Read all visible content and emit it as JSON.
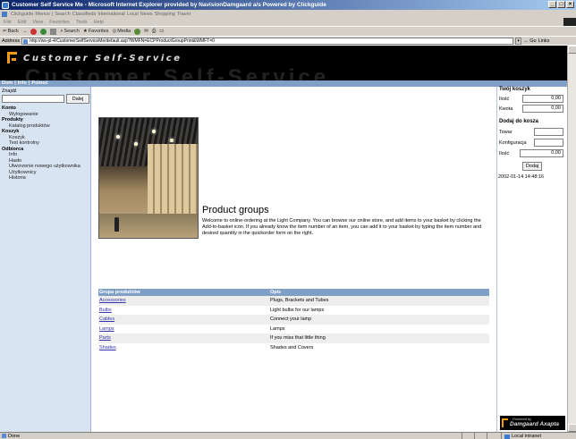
{
  "window": {
    "title": "Customer Self Service Me - Microsoft Internet Explorer provided by NavisionDamgaard a/s Powered by Clickguide"
  },
  "links_bar": [
    "Clickguide",
    "Menus",
    "Search",
    "Classifieds",
    "International",
    "Local",
    "News",
    "Shopping",
    "Travel"
  ],
  "menubar": [
    "File",
    "Edit",
    "View",
    "Favorites",
    "Tools",
    "Help"
  ],
  "toolbar": {
    "back": "Back",
    "search": "Search",
    "favorites": "Favorites",
    "media": "Media"
  },
  "address": {
    "label": "Address",
    "url": "http://ws-pl-4/CustomerSelfServiceMe/default.asp?WMFN=ECPProductGroupPrint&WMFT=0",
    "go": "Go",
    "links": "Links"
  },
  "site": {
    "title": "Customer Self-Service",
    "nav": [
      "Dom",
      "Info",
      "Pomoc"
    ]
  },
  "sidebar": {
    "search_label": "Znajdź",
    "search_value": "",
    "search_button": "Dalej",
    "sections": [
      {
        "title": "Konto",
        "items": [
          "Wylogowanie"
        ]
      },
      {
        "title": "Produkty",
        "items": [
          "Katalog produktów"
        ]
      },
      {
        "title": "Koszyk",
        "items": [
          "Koszyk",
          "Test kontrolny"
        ]
      },
      {
        "title": "Odbiorca",
        "items": [
          "Info",
          "Hasło",
          "Utworzenie nowego użytkownika",
          "Użytkownicy",
          "Historia"
        ]
      }
    ]
  },
  "main": {
    "title": "Product groups",
    "intro": "Welcome to online-ordering at the Light Company. You can browse our online store, and add items to your basket by clicking the Add-to-basket icon. If you already know the item number of an item, you can add it to your basket by typing the item number and desired quantity in the quickorder form on the right.",
    "table": {
      "headers": [
        "Grupa produktów",
        "Opis"
      ],
      "rows": [
        {
          "name": "Accessories",
          "desc": "Plugs, Brackets and Tubes"
        },
        {
          "name": "Bulbs",
          "desc": "Light bulbs for our lamps"
        },
        {
          "name": "Cables",
          "desc": "Connect your lamp"
        },
        {
          "name": "Lamps",
          "desc": "Lamps"
        },
        {
          "name": "Parts",
          "desc": "If you miss that little thing"
        },
        {
          "name": "Shades",
          "desc": "Shades and Covers"
        }
      ]
    }
  },
  "right": {
    "basket_title": "Twój koszyk",
    "qty_label": "Ilość",
    "qty_value": "0,00",
    "amount_label": "Kwota",
    "amount_value": "0,00",
    "add_title": "Dodaj do kosza",
    "item_label": "Towar",
    "config_label": "Konfiguracja",
    "add_qty_label": "Ilość",
    "add_qty_value": "0,00",
    "add_button": "Dodaj",
    "timestamp": "2002-01-14 14:48:16",
    "powered_small": "Powered by",
    "powered_big": "Damgaard Axapta"
  },
  "status": {
    "text": "Done",
    "zone": "Local intranet"
  },
  "colors": {
    "nav_blue": "#7f9fc6",
    "sidebar_bg": "#d9e4f3",
    "logo_orange": "#f39c12",
    "link": "#3333aa"
  }
}
